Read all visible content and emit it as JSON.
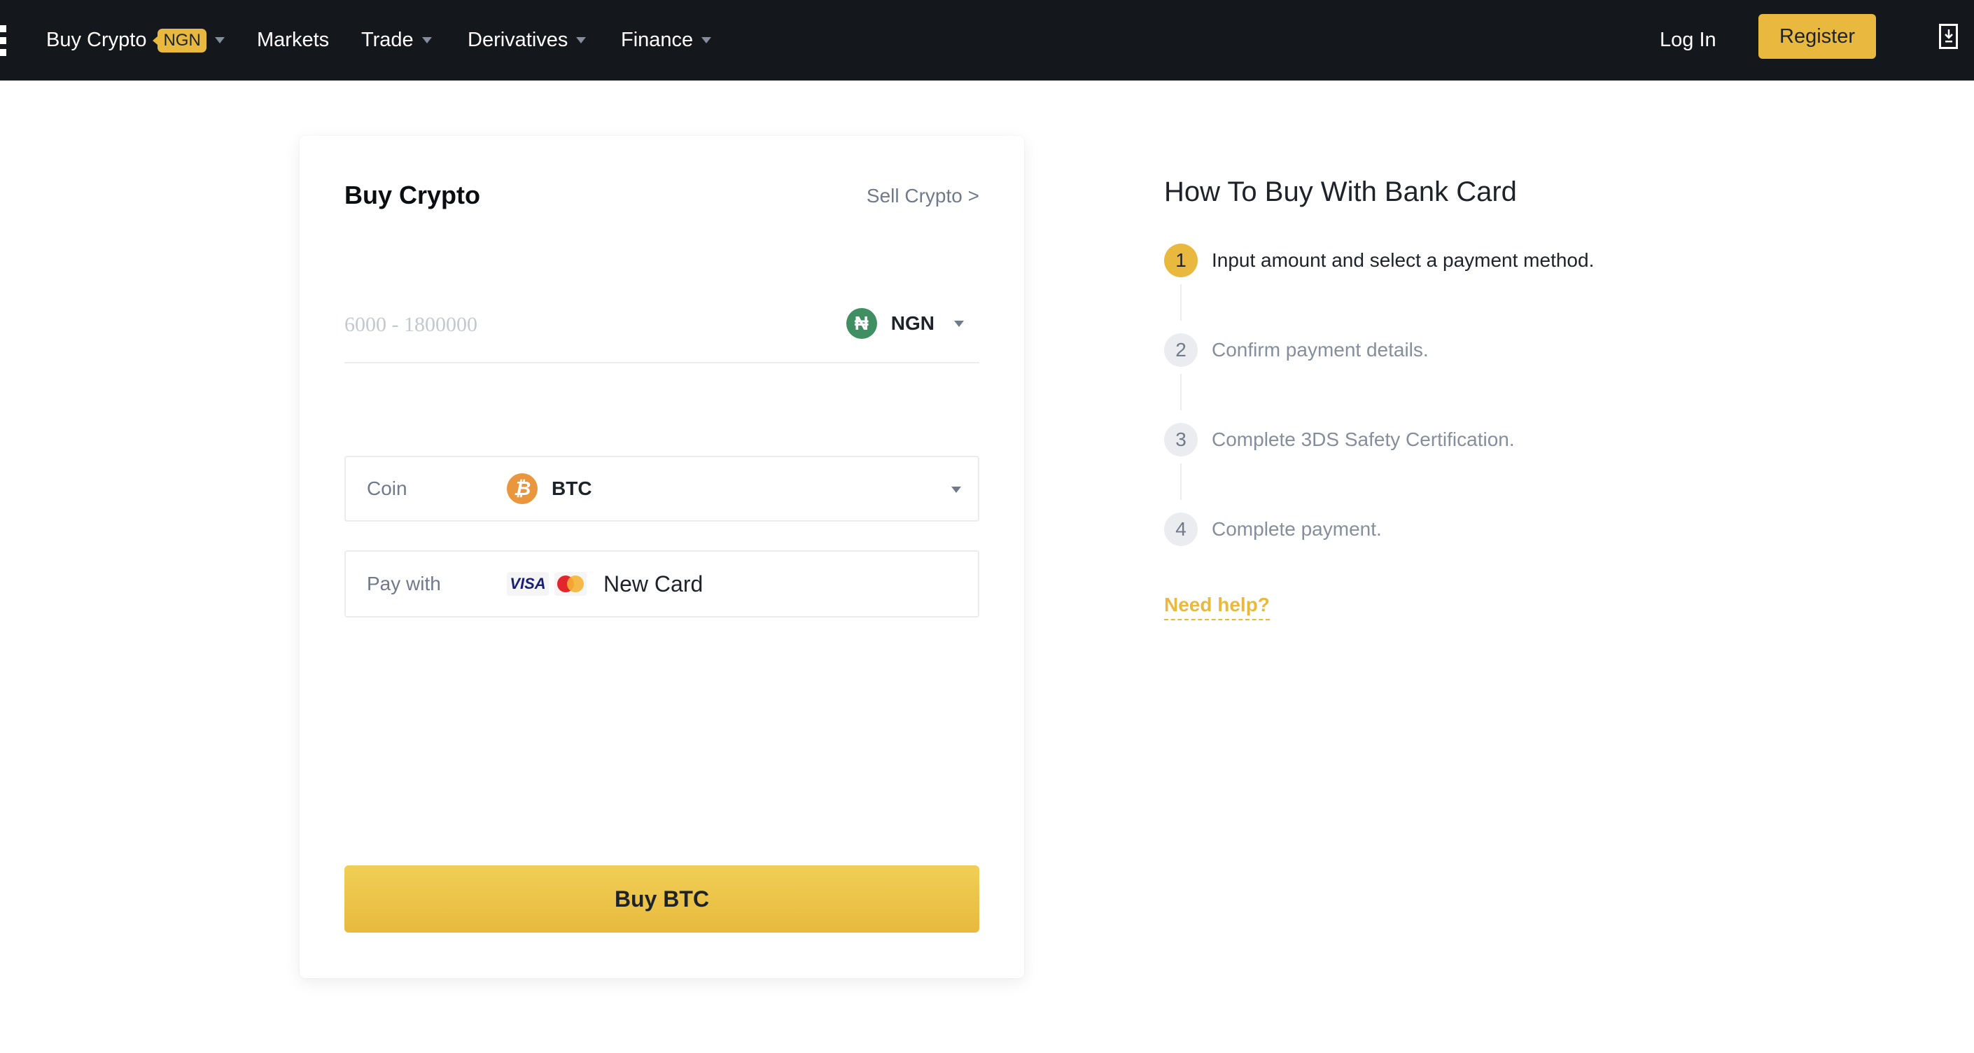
{
  "header": {
    "nav": [
      {
        "label": "Buy Crypto",
        "badge": "NGN",
        "has_dropdown": true
      },
      {
        "label": "Markets",
        "has_dropdown": false
      },
      {
        "label": "Trade",
        "has_dropdown": true
      },
      {
        "label": "Derivatives",
        "has_dropdown": true
      },
      {
        "label": "Finance",
        "has_dropdown": true
      }
    ],
    "login_label": "Log In",
    "register_label": "Register",
    "icons": {
      "app_menu": "grid-icon",
      "download": "download-icon"
    }
  },
  "buy_card": {
    "title": "Buy Crypto",
    "sell_link": "Sell Crypto >",
    "amount": {
      "value": "",
      "placeholder": "6000 - 1800000",
      "currency_symbol": "₦",
      "currency": "NGN"
    },
    "coin": {
      "label": "Coin",
      "symbol": "₿",
      "value": "BTC"
    },
    "pay_with": {
      "label": "Pay with",
      "visa": "VISA",
      "value": "New Card"
    },
    "buy_button": "Buy BTC"
  },
  "howto": {
    "title": "How To Buy With Bank Card",
    "steps": [
      {
        "num": "1",
        "text": "Input amount and select a payment method.",
        "active": true
      },
      {
        "num": "2",
        "text": "Confirm payment details.",
        "active": false
      },
      {
        "num": "3",
        "text": "Complete 3DS Safety Certification.",
        "active": false
      },
      {
        "num": "4",
        "text": "Complete payment.",
        "active": false
      }
    ],
    "help_link": "Need help?"
  },
  "colors": {
    "header_bg": "#14171c",
    "accent": "#e8b93e",
    "ngn_green": "#3f8f62",
    "btc_orange": "#e9963d",
    "muted_text": "#707a8a"
  }
}
